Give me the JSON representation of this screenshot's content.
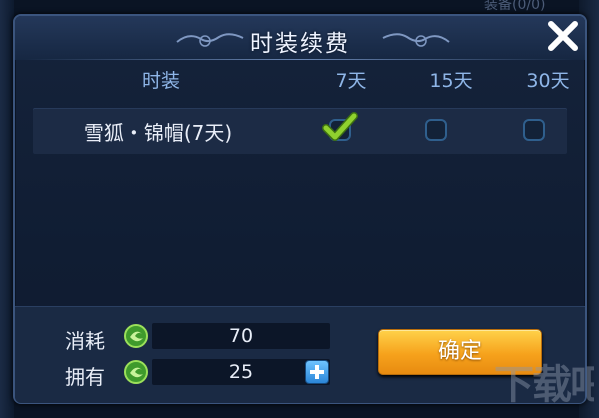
{
  "background": {
    "right_text": "装备(0/0)"
  },
  "dialog": {
    "title": "时装续费",
    "close_icon": "close-x-icon"
  },
  "table": {
    "headers": {
      "item": "时装",
      "d7": "7天",
      "d15": "15天",
      "d30": "30天"
    },
    "rows": [
      {
        "name": "雪狐・锦帽(7天)",
        "selected_option": "7天"
      }
    ]
  },
  "footer": {
    "cost_label": "消耗",
    "cost_value": "70",
    "own_label": "拥有",
    "own_value": "25",
    "currency_icon": "jade-currency-icon",
    "confirm_label": "确定"
  },
  "watermark": {
    "text": "下载吧"
  },
  "colors": {
    "header_text": "#8fb6e8",
    "confirm_button": "#f6a21c",
    "checkmark": "#7ec226",
    "plus_button": "#2b86d8"
  }
}
